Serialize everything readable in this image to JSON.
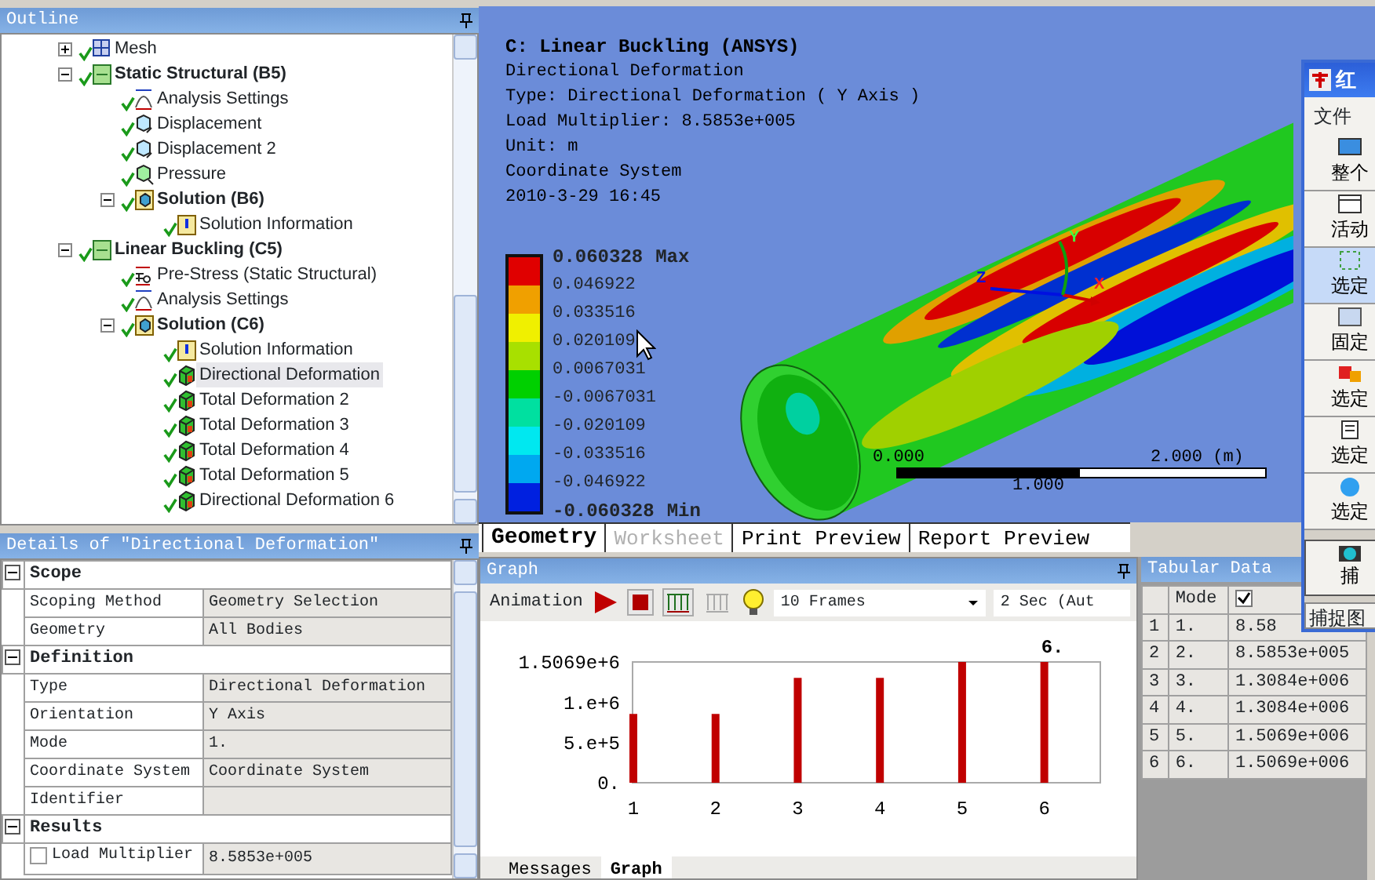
{
  "outline": {
    "title": "Outline",
    "items": [
      {
        "label": "Mesh",
        "kind": "mesh",
        "expanded": false,
        "selected": false
      },
      {
        "label": "Static Structural (B5)",
        "kind": "analysis",
        "expanded": true,
        "selected": false,
        "children": [
          {
            "label": "Analysis Settings",
            "kind": "settings",
            "selected": false
          },
          {
            "label": "Displacement",
            "kind": "support",
            "selected": false
          },
          {
            "label": "Displacement 2",
            "kind": "support",
            "selected": false
          },
          {
            "label": "Pressure",
            "kind": "load",
            "selected": false
          },
          {
            "label": "Solution (B6)",
            "kind": "solution",
            "expanded": true,
            "selected": false,
            "children": [
              {
                "label": "Solution Information",
                "kind": "info",
                "selected": false
              }
            ]
          }
        ]
      },
      {
        "label": "Linear Buckling (C5)",
        "kind": "analysis",
        "expanded": true,
        "selected": false,
        "children": [
          {
            "label": "Pre-Stress (Static Structural)",
            "kind": "prestress",
            "selected": false
          },
          {
            "label": "Analysis Settings",
            "kind": "settings",
            "selected": false
          },
          {
            "label": "Solution (C6)",
            "kind": "solution",
            "expanded": true,
            "selected": false,
            "children": [
              {
                "label": "Solution Information",
                "kind": "info",
                "selected": false
              },
              {
                "label": "Directional Deformation",
                "kind": "result",
                "selected": true
              },
              {
                "label": "Total Deformation 2",
                "kind": "result",
                "selected": false
              },
              {
                "label": "Total Deformation 3",
                "kind": "result",
                "selected": false
              },
              {
                "label": "Total Deformation 4",
                "kind": "result",
                "selected": false
              },
              {
                "label": "Total Deformation 5",
                "kind": "result",
                "selected": false
              },
              {
                "label": "Directional Deformation 6",
                "kind": "result",
                "selected": false
              }
            ]
          }
        ]
      }
    ]
  },
  "details": {
    "title": "Details of \"Directional Deformation\"",
    "groups": [
      {
        "title": "Scope",
        "expanded": true,
        "rows": [
          {
            "label": "Scoping Method",
            "value": "Geometry Selection"
          },
          {
            "label": "Geometry",
            "value": "All Bodies"
          }
        ]
      },
      {
        "title": "Definition",
        "expanded": true,
        "rows": [
          {
            "label": "Type",
            "value": "Directional Deformation"
          },
          {
            "label": "Orientation",
            "value": "Y Axis"
          },
          {
            "label": "Mode",
            "value": "1."
          },
          {
            "label": "Coordinate System",
            "value": "Coordinate System"
          },
          {
            "label": "Identifier"
          }
        ]
      },
      {
        "title": "Results",
        "expanded": true,
        "rows": [
          {
            "label": "Load Multiplier",
            "value": "8.5853e+005",
            "checked": false
          }
        ]
      }
    ]
  },
  "viewport": {
    "title": "C: Linear Buckling (ANSYS)",
    "lines": [
      "Directional Deformation",
      "Type: Directional Deformation ( Y Axis )",
      "Load Multiplier: 8.5853e+005",
      "Unit: m",
      "Coordinate System",
      "2010-3-29 16:45"
    ],
    "legend": {
      "labels": [
        {
          "text": "0.060328",
          "tag": "Max"
        },
        {
          "text": "0.046922"
        },
        {
          "text": "0.033516"
        },
        {
          "text": "0.020109"
        },
        {
          "text": "0.0067031"
        },
        {
          "text": "-0.0067031"
        },
        {
          "text": "-0.020109"
        },
        {
          "text": "-0.033516"
        },
        {
          "text": "-0.046922"
        },
        {
          "text": "-0.060328",
          "tag": "Min"
        }
      ],
      "bands": [
        {
          "color": "#e00000"
        },
        {
          "color": "#f0a000"
        },
        {
          "color": "#f0f000"
        },
        {
          "color": "#a8e000"
        },
        {
          "color": "#00d000"
        },
        {
          "color": "#00e0a0"
        },
        {
          "color": "#00e8f0"
        },
        {
          "color": "#00a8f0"
        },
        {
          "color": "#0020e0"
        }
      ]
    },
    "triad": {
      "x": "X",
      "y": "Y",
      "z": "Z"
    },
    "scale": {
      "start": "0.000",
      "middle": "1.000",
      "end": "2.000 (m)"
    },
    "tabs": [
      {
        "label": "Geometry",
        "selected": true,
        "disabled": false
      },
      {
        "label": "Worksheet",
        "selected": false,
        "disabled": true
      },
      {
        "label": "Print Preview",
        "selected": false,
        "disabled": false
      },
      {
        "label": "Report Preview",
        "selected": false,
        "disabled": false
      }
    ]
  },
  "graph": {
    "title": "Graph",
    "animation_label": "Animation",
    "frames": "10 Frames",
    "duration": "2 Sec (Aut",
    "chart_data": {
      "type": "bar",
      "categories": [
        "1",
        "2",
        "3",
        "4",
        "5",
        "6"
      ],
      "series": [
        {
          "color": "#c00000",
          "values": [
            858530,
            858530,
            1308400,
            1308400,
            1506900,
            1506900
          ]
        }
      ],
      "ylim": [
        0,
        1506900
      ],
      "yticks": [
        {
          "value": 0,
          "label": "0."
        },
        {
          "value": 500000,
          "label": "5.e+5"
        },
        {
          "value": 1000000,
          "label": "1.e+6"
        },
        {
          "value": 1506900,
          "label": "1.5069e+6"
        }
      ],
      "annotations": [
        "6."
      ]
    },
    "tabs": [
      {
        "label": "Messages",
        "selected": false
      },
      {
        "label": "Graph",
        "selected": true
      }
    ]
  },
  "tabular": {
    "title": "Tabular Data",
    "columns": [
      "",
      "Mode"
    ],
    "header_checked": true,
    "rows": [
      [
        "1",
        "1.",
        "8.58"
      ],
      [
        "2",
        "2.",
        "8.5853e+005"
      ],
      [
        "3",
        "3.",
        "1.3084e+006"
      ],
      [
        "4",
        "4.",
        "1.3084e+006"
      ],
      [
        "5",
        "5.",
        "1.5069e+006"
      ],
      [
        "6",
        "6.",
        "1.5069e+006"
      ]
    ]
  },
  "capture_window": {
    "title": "红",
    "menu": "文件",
    "buttons": [
      {
        "label": "整个",
        "selected": false
      },
      {
        "label": "活动",
        "selected": false
      },
      {
        "label": "选定",
        "selected": true
      },
      {
        "label": "固定",
        "selected": false
      },
      {
        "label": "选定",
        "selected": false
      },
      {
        "label": "选定",
        "selected": false
      },
      {
        "label": "选定",
        "selected": false
      }
    ],
    "capture": "捕",
    "status": "捕捉图"
  }
}
